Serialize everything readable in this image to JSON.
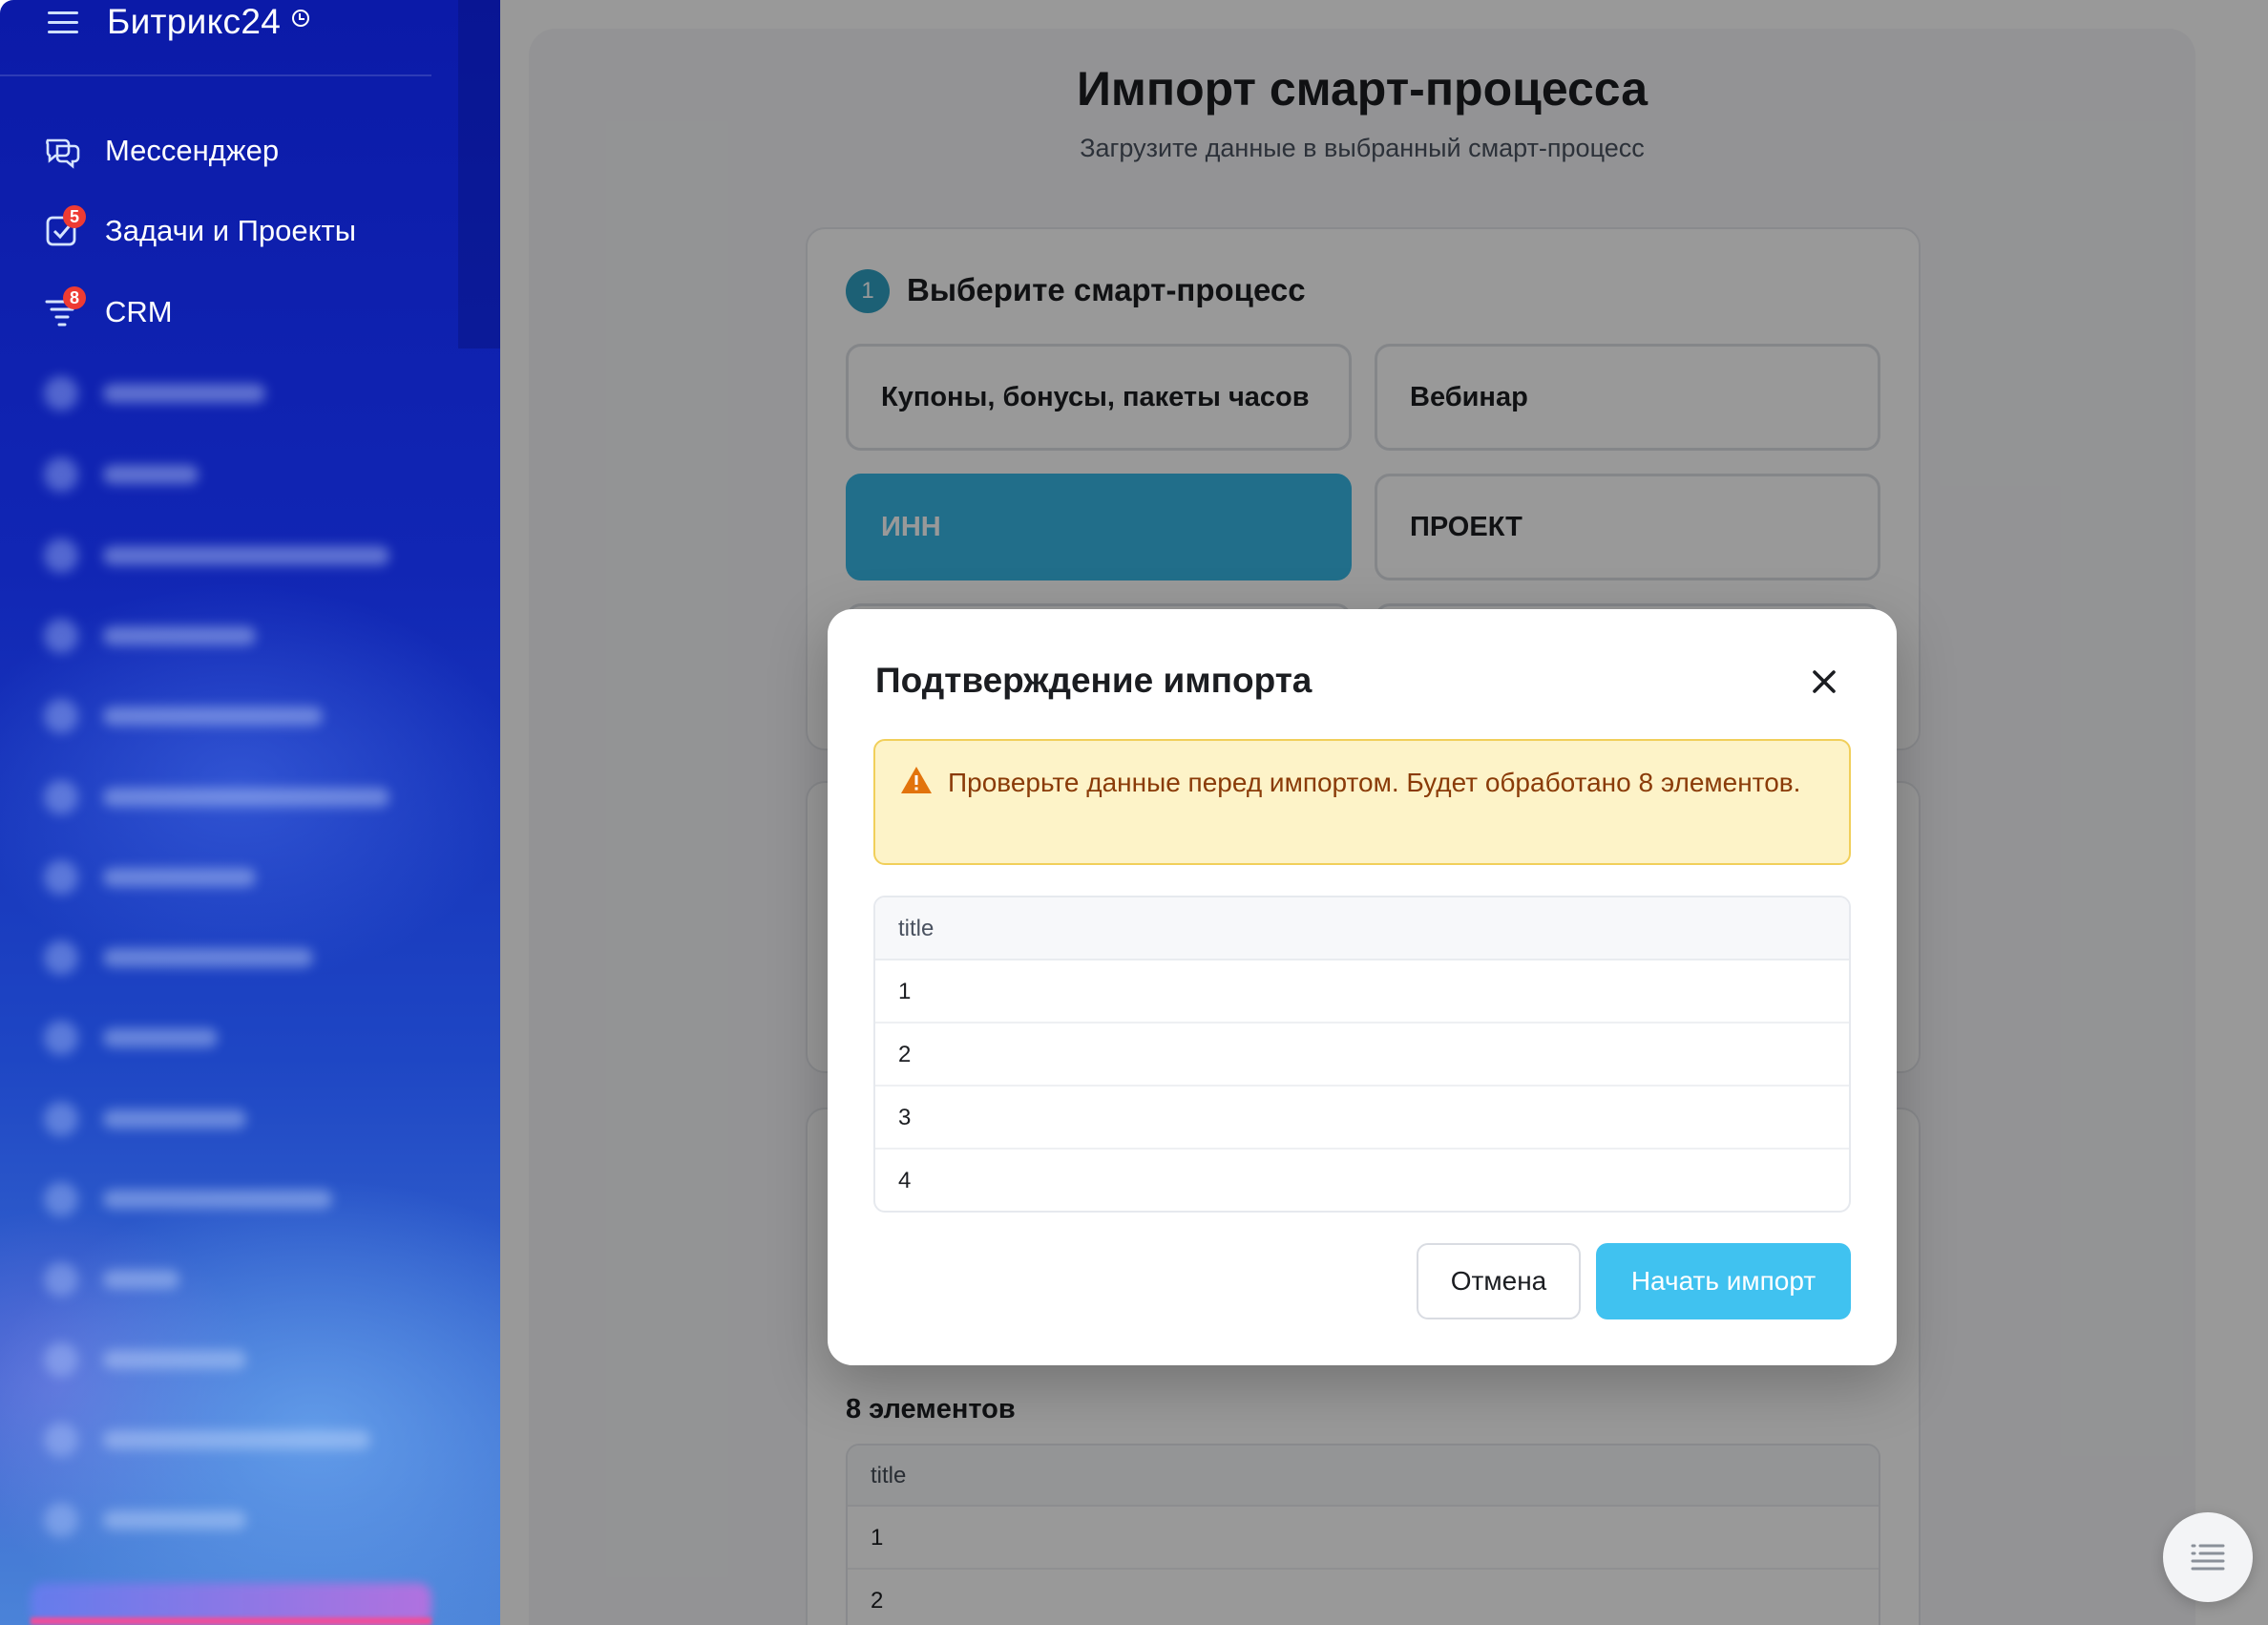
{
  "sidebar": {
    "brand": "Битрикс24",
    "items": [
      {
        "label": "Мессенджер",
        "icon": "chat-icon",
        "badge": ""
      },
      {
        "label": "Задачи и Проекты",
        "icon": "tasks-checkbox-icon",
        "badge": "5"
      },
      {
        "label": "CRM",
        "icon": "crm-funnel-icon",
        "badge": "8"
      }
    ]
  },
  "page": {
    "title": "Импорт смарт-процесса",
    "subtitle": "Загрузите данные в выбранный смарт-процесс"
  },
  "step1": {
    "number": "1",
    "title": "Выберите смарт-процесс",
    "options": [
      {
        "label": "Купоны, бонусы, пакеты часов",
        "selected": false
      },
      {
        "label": "Вебинар",
        "selected": false
      },
      {
        "label": "ИНН",
        "selected": true
      },
      {
        "label": "ПРОЕКТ",
        "selected": false
      }
    ]
  },
  "preview": {
    "count_label": "8 элементов",
    "column": "title",
    "rows": [
      "1",
      "2"
    ]
  },
  "modal": {
    "title": "Подтверждение импорта",
    "warning": "Проверьте данные перед импортом. Будет обработано 8 элементов.",
    "table": {
      "column": "title",
      "rows": [
        "1",
        "2",
        "3",
        "4"
      ]
    },
    "cancel_label": "Отмена",
    "start_label": "Начать импорт"
  },
  "colors": {
    "accent": "#40c2f0",
    "selected_option": "#37b7e6",
    "badge": "#ee3b33",
    "warning_bg": "#fdf3c8",
    "warning_text": "#8a3b08"
  }
}
